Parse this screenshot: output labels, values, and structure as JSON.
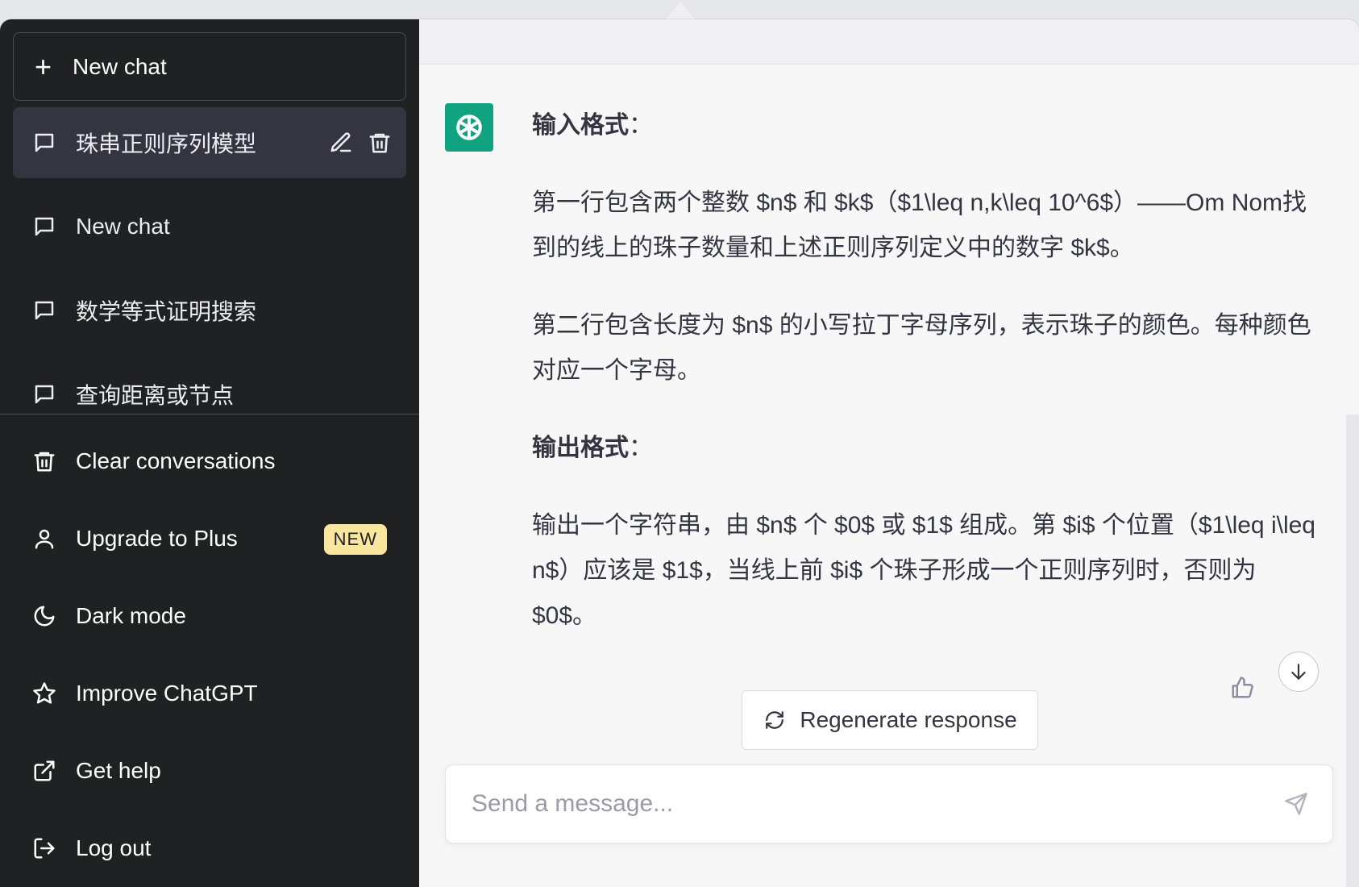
{
  "sidebar": {
    "new_chat_label": "New chat",
    "history": [
      {
        "label": "珠串正则序列模型",
        "active": true
      },
      {
        "label": "New chat",
        "active": false
      },
      {
        "label": "数学等式证明搜索",
        "active": false
      },
      {
        "label": "查询距离或节点",
        "active": false
      }
    ],
    "menu": {
      "clear": "Clear conversations",
      "upgrade": "Upgrade to Plus",
      "upgrade_badge": "NEW",
      "dark_mode": "Dark mode",
      "improve": "Improve ChatGPT",
      "help": "Get help",
      "logout": "Log out"
    }
  },
  "message": {
    "input_heading": "输入格式",
    "input_p1": "第一行包含两个整数 $n$ 和 $k$（$1\\leq n,k\\leq 10^6$）——Om Nom找到的线上的珠子数量和上述正则序列定义中的数字 $k$。",
    "input_p2": "第二行包含长度为 $n$ 的小写拉丁字母序列，表示珠子的颜色。每种颜色对应一个字母。",
    "output_heading": "输出格式",
    "output_p1": "输出一个字符串，由 $n$ 个 $0$ 或 $1$ 组成。第 $i$ 个位置（$1\\leq i\\leq n$）应该是 $1$，当线上前 $i$ 个珠子形成一个正则序列时，否则为 $0$。"
  },
  "regenerate_label": "Regenerate response",
  "composer": {
    "placeholder": "Send a message..."
  },
  "colors": {
    "sidebar_bg": "#202123",
    "accent": "#10a37f",
    "badge": "#fae69e"
  }
}
